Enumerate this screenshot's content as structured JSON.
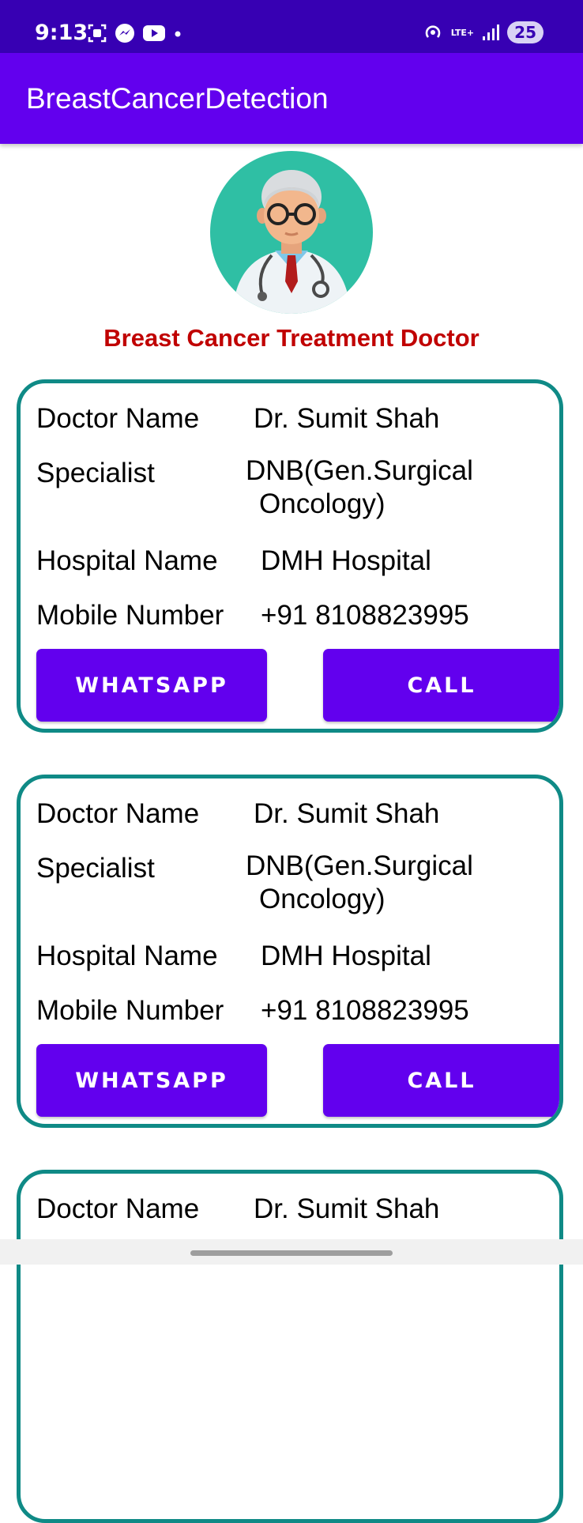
{
  "status_bar": {
    "time": "9:13",
    "network": "LTE+",
    "battery": "25"
  },
  "app_bar": {
    "title": "BreastCancerDetection"
  },
  "page": {
    "heading": "Breast Cancer Treatment Doctor"
  },
  "labels": {
    "doctor_name": "Doctor Name",
    "specialist": "Specialist",
    "hospital_name": "Hospital Name",
    "mobile_number": "Mobile Number",
    "whatsapp_button": "WHATSAPP",
    "call_button": "CALL"
  },
  "doctors": [
    {
      "name": "Dr. Sumit Shah",
      "specialist_line1": "DNB(Gen.Surgical",
      "specialist_line2": "Oncology)",
      "hospital": "DMH Hospital",
      "mobile": "+91 8108823995"
    },
    {
      "name": "Dr. Sumit Shah",
      "specialist_line1": "DNB(Gen.Surgical",
      "specialist_line2": "Oncology)",
      "hospital": "DMH Hospital",
      "mobile": "+91 8108823995"
    },
    {
      "name": "Dr. Sumit Shah"
    }
  ],
  "colors": {
    "status_bar": "#3700b3",
    "app_bar": "#6200ee",
    "button": "#6200ee",
    "heading": "#c00000",
    "card_border": "#0f8a86",
    "avatar_bg": "#2fbfa4"
  },
  "icons": [
    "screenshot-icon",
    "messenger-icon",
    "youtube-icon",
    "notification-dot-icon",
    "hotspot-icon",
    "signal-icon",
    "battery-icon",
    "doctor-avatar-icon"
  ]
}
